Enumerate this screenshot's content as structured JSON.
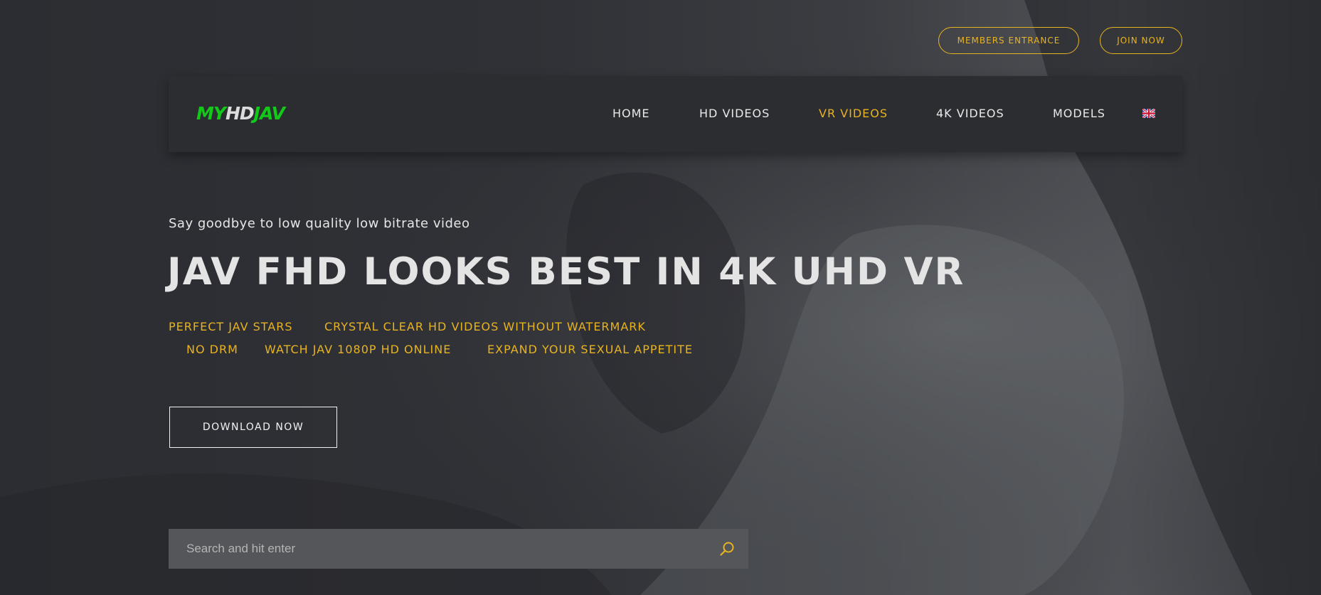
{
  "top_buttons": {
    "members": "MEMBERS ENTRANCE",
    "join": "JOIN NOW"
  },
  "logo": {
    "part1": "MY",
    "part2": "HD",
    "part3": "JAV"
  },
  "nav": {
    "items": [
      {
        "label": "HOME",
        "active": false
      },
      {
        "label": "HD VIDEOS",
        "active": false
      },
      {
        "label": "VR VIDEOS",
        "active": true
      },
      {
        "label": "4K VIDEOS",
        "active": false
      },
      {
        "label": "MODELS",
        "active": false
      }
    ],
    "language_icon": "uk-flag-icon"
  },
  "hero": {
    "tagline": "Say goodbye to low quality low bitrate video",
    "headline": "JAV FHD LOOKS BEST IN 4K UHD VR",
    "features": [
      "PERFECT JAV STARS",
      "CRYSTAL CLEAR HD VIDEOS WITHOUT WATERMARK",
      "NO DRM",
      "WATCH JAV 1080P HD ONLINE",
      "EXPAND YOUR SEXUAL APPETITE"
    ],
    "cta": "DOWNLOAD NOW"
  },
  "search": {
    "placeholder": "Search and hit enter",
    "icon": "search-icon"
  },
  "colors": {
    "accent": "#e8b321",
    "logo_green": "#12c91a",
    "navbar_bg": "#2c2d31",
    "search_bg": "#55565a"
  }
}
